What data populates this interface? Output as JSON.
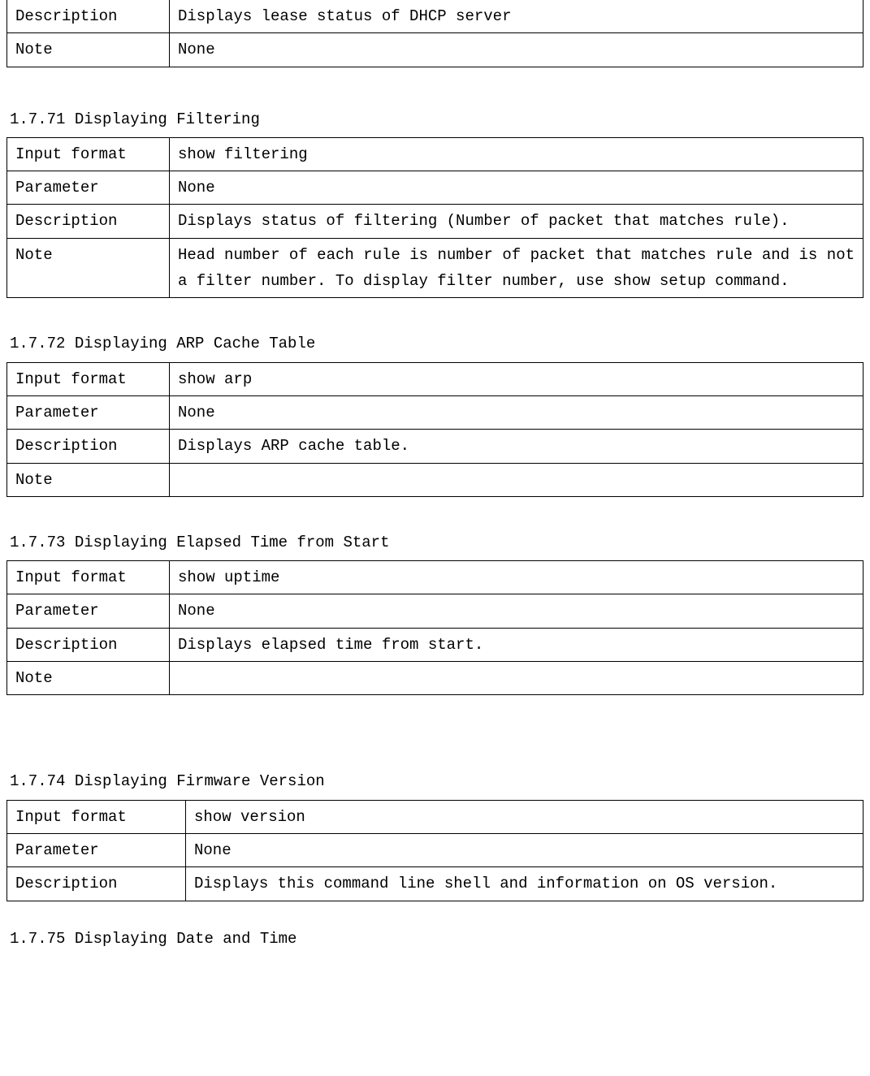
{
  "top_partial_table": {
    "rows": [
      {
        "label": "Description",
        "value": "Displays lease status of DHCP server"
      },
      {
        "label": "Note",
        "value": "None"
      }
    ]
  },
  "sections": [
    {
      "title": "1.7.71 Displaying Filtering",
      "table_class": "cmd",
      "extra_gap": false,
      "rows": [
        {
          "label": "Input format",
          "value": "show filtering"
        },
        {
          "label": "Parameter",
          "value": "None"
        },
        {
          "label": "Description",
          "value": "Displays status of filtering (Number of packet that matches rule).",
          "justify": true
        },
        {
          "label": "Note",
          "value": "Head number of each rule is number of packet that matches rule and is not a filter number. To display filter number, use show setup command.",
          "justify": true
        }
      ]
    },
    {
      "title": "1.7.72 Displaying ARP Cache Table",
      "table_class": "cmd",
      "extra_gap": false,
      "rows": [
        {
          "label": "Input format",
          "value": "show arp"
        },
        {
          "label": "Parameter",
          "value": "None"
        },
        {
          "label": "Description",
          "value": "Displays ARP cache table."
        },
        {
          "label": "Note",
          "value": ""
        }
      ]
    },
    {
      "title": "1.7.73 Displaying Elapsed Time from Start",
      "table_class": "cmd",
      "extra_gap": false,
      "rows": [
        {
          "label": "Input format",
          "value": "show uptime"
        },
        {
          "label": "Parameter",
          "value": "None"
        },
        {
          "label": "Description",
          "value": "Displays elapsed time from start."
        },
        {
          "label": "Note",
          "value": ""
        }
      ]
    },
    {
      "title": "1.7.74 Displaying Firmware Version",
      "table_class": "cmd cmd2",
      "extra_gap": true,
      "rows": [
        {
          "label": "Input format",
          "value": "show version"
        },
        {
          "label": "Parameter",
          "value": "None"
        },
        {
          "label": "Description",
          "value": "Displays this command line shell and information on OS version.",
          "justify2": true
        }
      ]
    }
  ],
  "trailing_title": "1.7.75 Displaying Date and Time"
}
